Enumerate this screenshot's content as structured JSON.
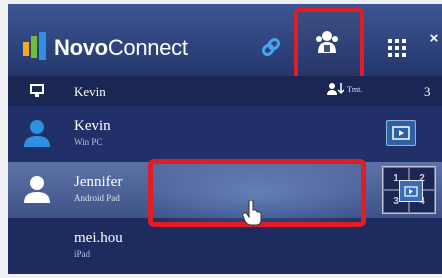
{
  "app": {
    "brand_bold": "Novo",
    "brand_rest": "Connect",
    "icons": {
      "logo": "novoconnect-logo-icon",
      "link": "link-icon",
      "users": "users-group-icon",
      "grid": "grid-menu-icon",
      "close": "close-icon"
    },
    "close_label": "×"
  },
  "list_header": {
    "name": "Kevin",
    "sort_label": "Tmt.",
    "count": "3"
  },
  "users": [
    {
      "name": "Kevin",
      "device": "Win PC"
    },
    {
      "name": "Jennifer",
      "device": "Android Pad"
    },
    {
      "name": "mei.hou",
      "device": "iPad"
    }
  ],
  "split_control": {
    "q1": "1",
    "q2": "2",
    "q3": "3",
    "q4": "4"
  },
  "colors": {
    "header": "#2c3f78",
    "list_bg": "#1f2d63",
    "selected_row": "#4e639a",
    "highlight": "#e01d25",
    "presence_blue": "#2f8fe0"
  }
}
